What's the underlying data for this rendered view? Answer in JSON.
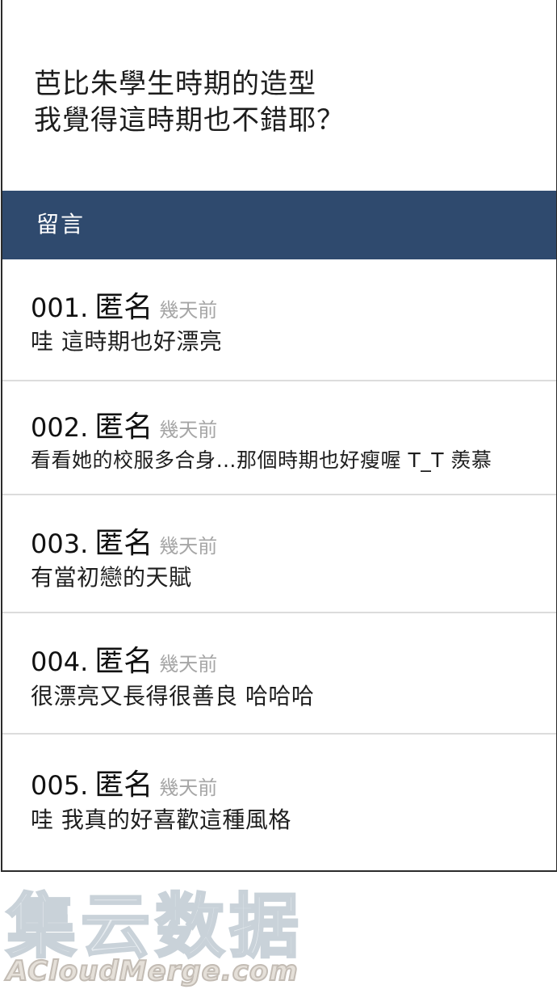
{
  "caption": {
    "line1": "芭比朱學生時期的造型",
    "line2": "我覺得這時期也不錯耶？"
  },
  "comments_section": {
    "title": "留言"
  },
  "comments": [
    {
      "number": "001.",
      "author": "匿名",
      "time": "幾天前",
      "text": "哇 這時期也好漂亮"
    },
    {
      "number": "002.",
      "author": "匿名",
      "time": "幾天前",
      "text": "看看她的校服多合身…那個時期也好瘦喔 T_T 羨慕"
    },
    {
      "number": "003.",
      "author": "匿名",
      "time": "幾天前",
      "text": "有當初戀的天賦"
    },
    {
      "number": "004.",
      "author": "匿名",
      "time": "幾天前",
      "text": "很漂亮又長得很善良 哈哈哈"
    },
    {
      "number": "005.",
      "author": "匿名",
      "time": "幾天前",
      "text": "哇 我真的好喜歡這種風格"
    }
  ],
  "watermark": {
    "chinese": "集云数据",
    "english": "ACloudMerge.com"
  },
  "colors": {
    "header_bg": "#2f4a6e",
    "time_text": "#a6a6a6",
    "divider": "#dcdcdc"
  }
}
